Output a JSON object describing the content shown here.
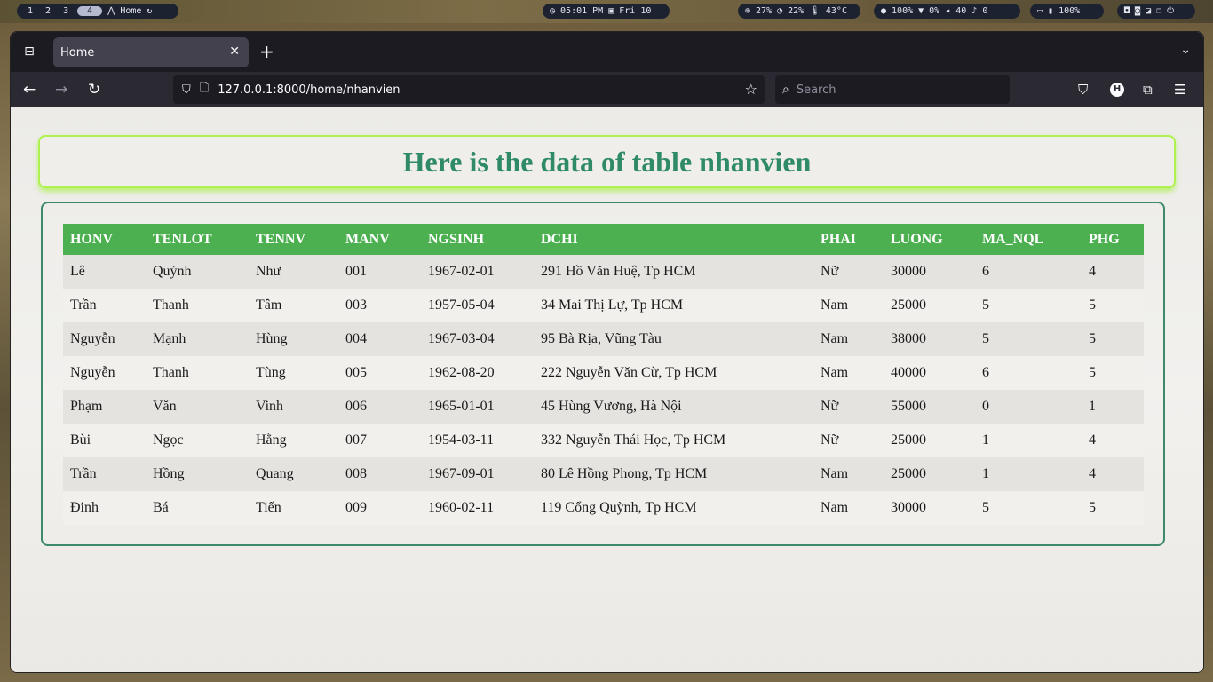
{
  "topbar": {
    "workspaces": [
      "1",
      "2",
      "3",
      "4"
    ],
    "active_workspace": "4",
    "window_title": "Home",
    "clock": "05:01 PM",
    "date": "Fri 10",
    "cpu": "27%",
    "ram": "22%",
    "temp": "43°C",
    "brightness": "100%",
    "wifi": "0%",
    "volume": "40",
    "mic": "0",
    "battery": "100%"
  },
  "browser": {
    "tab_title": "Home",
    "url": "127.0.0.1:8000/home/nhanvien",
    "search_placeholder": "Search",
    "profile_initial": "H"
  },
  "page": {
    "heading": "Here is the data of table nhanvien"
  },
  "table": {
    "columns": [
      "HONV",
      "TENLOT",
      "TENNV",
      "MANV",
      "NGSINH",
      "DCHI",
      "PHAI",
      "LUONG",
      "MA_NQL",
      "PHG"
    ],
    "rows": [
      [
        "Lê",
        "Quỳnh",
        "Như",
        "001",
        "1967-02-01",
        "291 Hồ Văn Huệ, Tp HCM",
        "Nữ",
        "30000",
        "6",
        "4"
      ],
      [
        "Trần",
        "Thanh",
        "Tâm",
        "003",
        "1957-05-04",
        "34 Mai Thị Lự, Tp HCM",
        "Nam",
        "25000",
        "5",
        "5"
      ],
      [
        "Nguyễn",
        "Mạnh",
        "Hùng",
        "004",
        "1967-03-04",
        "95 Bà Rịa, Vũng Tàu",
        "Nam",
        "38000",
        "5",
        "5"
      ],
      [
        "Nguyễn",
        "Thanh",
        "Tùng",
        "005",
        "1962-08-20",
        "222 Nguyễn Văn Cừ, Tp HCM",
        "Nam",
        "40000",
        "6",
        "5"
      ],
      [
        "Phạm",
        "Văn",
        "Vinh",
        "006",
        "1965-01-01",
        "45 Hùng Vương, Hà Nội",
        "Nữ",
        "55000",
        "0",
        "1"
      ],
      [
        "Bùi",
        "Ngọc",
        "Hằng",
        "007",
        "1954-03-11",
        "332 Nguyễn Thái Học, Tp HCM",
        "Nữ",
        "25000",
        "1",
        "4"
      ],
      [
        "Trần",
        "Hồng",
        "Quang",
        "008",
        "1967-09-01",
        "80 Lê Hồng Phong, Tp HCM",
        "Nam",
        "25000",
        "1",
        "4"
      ],
      [
        "Đinh",
        "Bá",
        "Tiến",
        "009",
        "1960-02-11",
        "119 Cổng Quỳnh, Tp HCM",
        "Nam",
        "30000",
        "5",
        "5"
      ]
    ]
  }
}
